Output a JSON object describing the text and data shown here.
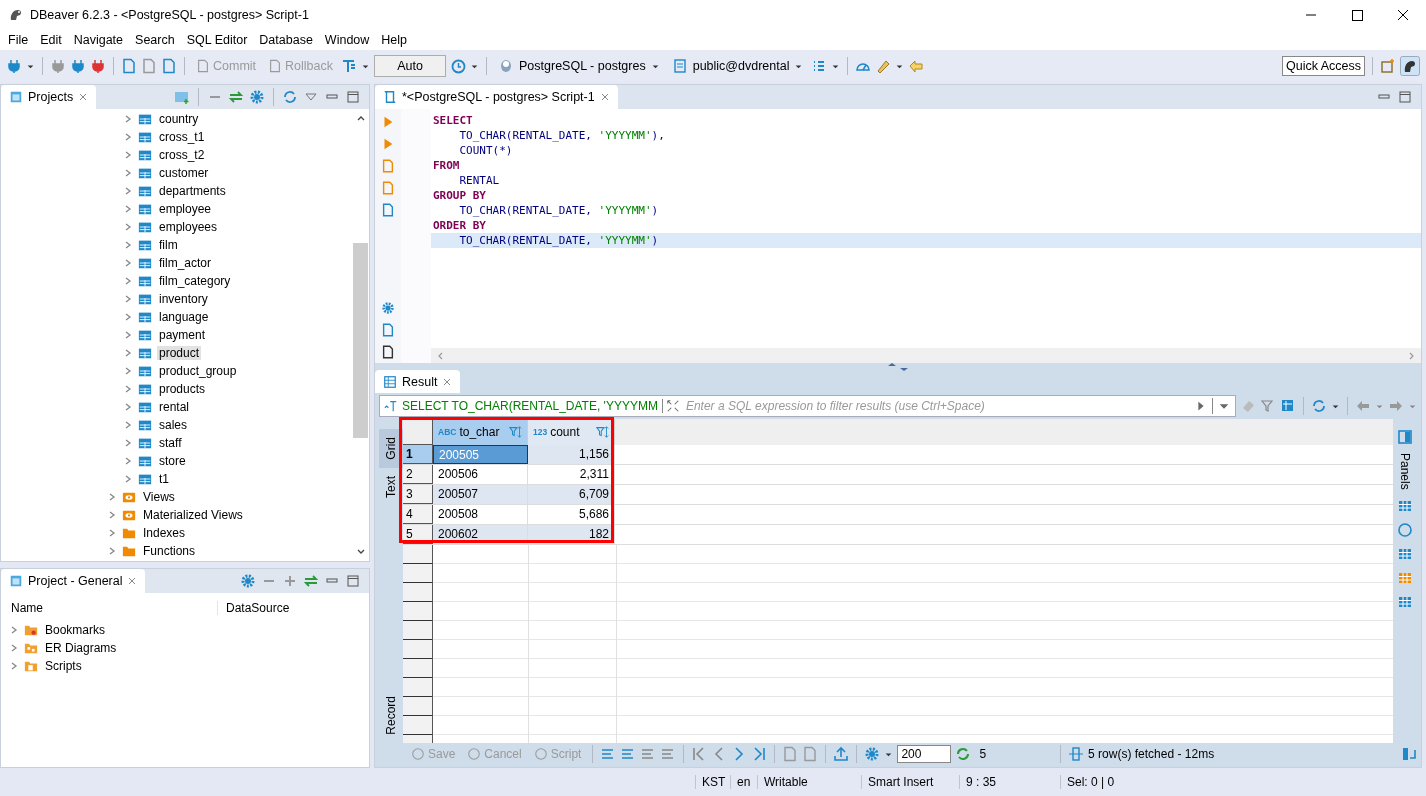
{
  "window": {
    "title": "DBeaver 6.2.3 - <PostgreSQL - postgres> Script-1"
  },
  "menu": [
    "File",
    "Edit",
    "Navigate",
    "Search",
    "SQL Editor",
    "Database",
    "Window",
    "Help"
  ],
  "toolbar": {
    "commit": {
      "label": "Commit",
      "disabled": true
    },
    "rollback": {
      "label": "Rollback",
      "disabled": true
    },
    "transaction_mode": "Auto",
    "connection": "PostgreSQL - postgres",
    "schema": "public@dvdrental",
    "quick_access": "Quick Access"
  },
  "projects_panel": {
    "title": "Projects",
    "tables": [
      {
        "name": "country",
        "selected": false
      },
      {
        "name": "cross_t1",
        "selected": false
      },
      {
        "name": "cross_t2",
        "selected": false
      },
      {
        "name": "customer",
        "selected": false
      },
      {
        "name": "departments",
        "selected": false
      },
      {
        "name": "employee",
        "selected": false
      },
      {
        "name": "employees",
        "selected": false
      },
      {
        "name": "film",
        "selected": false
      },
      {
        "name": "film_actor",
        "selected": false
      },
      {
        "name": "film_category",
        "selected": false
      },
      {
        "name": "inventory",
        "selected": false
      },
      {
        "name": "language",
        "selected": false
      },
      {
        "name": "payment",
        "selected": false
      },
      {
        "name": "product",
        "selected": true
      },
      {
        "name": "product_group",
        "selected": false
      },
      {
        "name": "products",
        "selected": false
      },
      {
        "name": "rental",
        "selected": false
      },
      {
        "name": "sales",
        "selected": false
      },
      {
        "name": "staff",
        "selected": false
      },
      {
        "name": "store",
        "selected": false
      },
      {
        "name": "t1",
        "selected": false
      }
    ],
    "folders": [
      {
        "name": "Views",
        "kind": "views"
      },
      {
        "name": "Materialized Views",
        "kind": "views"
      },
      {
        "name": "Indexes",
        "kind": "folder"
      },
      {
        "name": "Functions",
        "kind": "folder"
      }
    ]
  },
  "project_general": {
    "title": "Project - General",
    "columns": [
      "Name",
      "DataSource"
    ],
    "items": [
      {
        "name": "Bookmarks",
        "kind": "bookmarks"
      },
      {
        "name": "ER Diagrams",
        "kind": "diagrams"
      },
      {
        "name": "Scripts",
        "kind": "scripts"
      }
    ]
  },
  "editor": {
    "tab": "*<PostgreSQL - postgres> Script-1",
    "lines": [
      {
        "current": false,
        "parts": [
          {
            "kind": "keyword",
            "text": "SELECT"
          }
        ]
      },
      {
        "current": false,
        "parts": [
          {
            "kind": "plain",
            "text": "    TO_CHAR(RENTAL_DATE, "
          },
          {
            "kind": "string",
            "text": "'YYYYMM'"
          },
          {
            "kind": "plain",
            "text": "),"
          }
        ]
      },
      {
        "current": false,
        "parts": [
          {
            "kind": "plain",
            "text": "    COUNT(*)"
          }
        ]
      },
      {
        "current": false,
        "parts": [
          {
            "kind": "keyword",
            "text": "FROM"
          }
        ]
      },
      {
        "current": false,
        "parts": [
          {
            "kind": "plain",
            "text": "    RENTAL"
          }
        ]
      },
      {
        "current": false,
        "parts": [
          {
            "kind": "keyword",
            "text": "GROUP BY"
          }
        ]
      },
      {
        "current": false,
        "parts": [
          {
            "kind": "plain",
            "text": "    TO_CHAR(RENTAL_DATE, "
          },
          {
            "kind": "string",
            "text": "'YYYYMM'"
          },
          {
            "kind": "plain",
            "text": ")"
          }
        ]
      },
      {
        "current": false,
        "parts": [
          {
            "kind": "keyword",
            "text": "ORDER BY"
          }
        ]
      },
      {
        "current": true,
        "parts": [
          {
            "kind": "plain",
            "text": "    TO_CHAR(RENTAL_DATE, "
          },
          {
            "kind": "string",
            "text": "'YYYYMM'"
          },
          {
            "kind": "plain",
            "text": ")"
          }
        ]
      }
    ]
  },
  "result": {
    "tab": "Result",
    "query": "SELECT TO_CHAR(RENTAL_DATE, 'YYYYMM",
    "filter_placeholder": "Enter a SQL expression to filter results (use Ctrl+Space)",
    "side_tabs": [
      {
        "label": "Grid",
        "selected": true
      },
      {
        "label": "Text",
        "selected": false
      }
    ],
    "record_tab": "Record",
    "columns": [
      {
        "type_badge": "ABC",
        "name": "to_char",
        "kind": "text"
      },
      {
        "type_badge": "123",
        "name": "count",
        "kind": "number"
      }
    ],
    "rows": [
      {
        "number": "1",
        "selected": true,
        "cells": [
          "200505",
          "1,156"
        ]
      },
      {
        "number": "2",
        "selected": false,
        "cells": [
          "200506",
          "2,311"
        ]
      },
      {
        "number": "3",
        "selected": false,
        "cells": [
          "200507",
          "6,709"
        ]
      },
      {
        "number": "4",
        "selected": false,
        "cells": [
          "200508",
          "5,686"
        ]
      },
      {
        "number": "5",
        "selected": false,
        "cells": [
          "200602",
          "182"
        ]
      }
    ],
    "panels_tab": "Panels",
    "actions": [
      {
        "label": "Save",
        "disabled": true
      },
      {
        "label": "Cancel",
        "disabled": true
      },
      {
        "label": "Script",
        "disabled": true
      }
    ],
    "fetch_size": "200",
    "row_count": "5",
    "fetch_status": "5 row(s) fetched - 12ms"
  },
  "status_bar": [
    "KST",
    "en",
    "Writable",
    "Smart Insert",
    "9 : 35",
    "Sel: 0 | 0"
  ]
}
